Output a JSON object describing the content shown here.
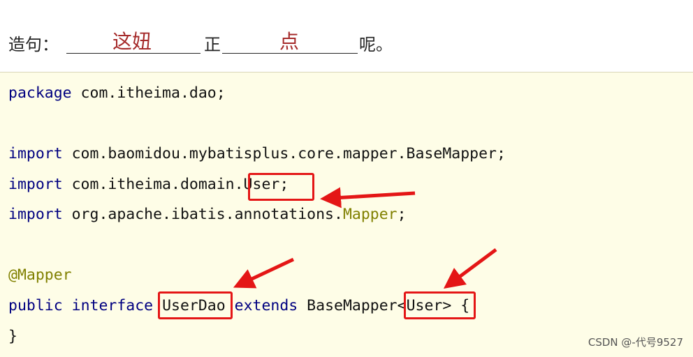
{
  "header": {
    "prompt_label": "造句：",
    "fill1": "这妞",
    "middle": "正",
    "fill2": "点",
    "ending": "呢。"
  },
  "code": {
    "line1": {
      "kw": "package",
      "rest": " com.itheima.dao;"
    },
    "line2": {
      "kw": "import",
      "rest": " com.baomidou.mybatisplus.core.mapper.BaseMapper;"
    },
    "line3": {
      "kw": "import",
      "rest": " com.itheima.domain.User;"
    },
    "line4": {
      "kw": "import",
      "rest": " org.apache.ibatis.annotations.",
      "ann": "Mapper",
      "end": ";"
    },
    "line5": {
      "ann": "@Mapper"
    },
    "line6": {
      "kw1": "public",
      "kw2": "interface",
      "name": " UserDao ",
      "kw3": "extends",
      "rest": " BaseMapper<User> {"
    },
    "line7": {
      "text": "}"
    }
  },
  "watermark": "CSDN @-代号9527",
  "colors": {
    "highlight": "#e41616",
    "code_bg": "#fefde7",
    "keyword": "#000080",
    "annotation": "#808000",
    "fill_text": "#a52a2a"
  }
}
